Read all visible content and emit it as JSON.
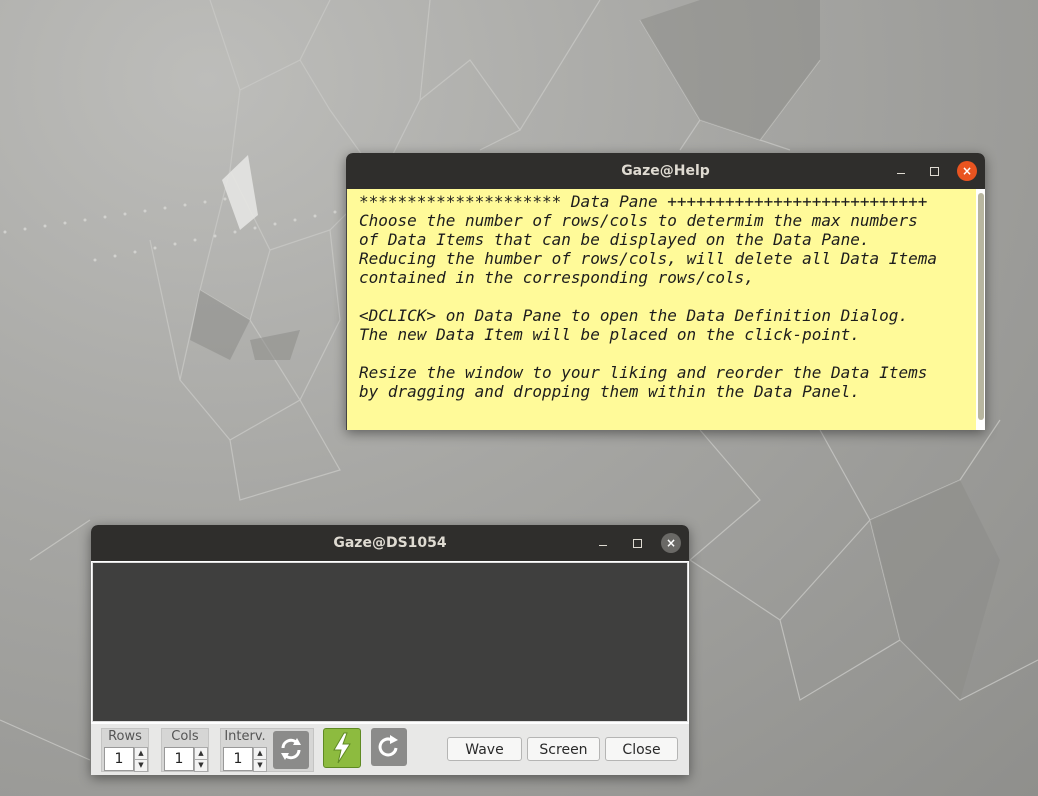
{
  "help_window": {
    "title": "Gaze@Help",
    "text": "********************* Data Pane +++++++++++++++++++++++++++\nChoose the number of rows/cols to determim the max numbers\nof Data Items that can be displayed on the Data Pane.\nReducing the humber of rows/cols, will delete all Data Itema\ncontained in the corresponding rows/cols,\n\n<DCLICK> on Data Pane to open the Data Definition Dialog.\nThe new Data Item will be placed on the click-point.\n\nResize the window to your liking and reorder the Data Items\nby dragging and dropping them within the Data Panel."
  },
  "ds_window": {
    "title": "Gaze@DS1054",
    "rows": {
      "label": "Rows",
      "value": "1"
    },
    "cols": {
      "label": "Cols",
      "value": "1"
    },
    "interval": {
      "label": "Interv.",
      "value": "1"
    },
    "buttons": {
      "wave": "Wave",
      "screen": "Screen",
      "close": "Close"
    },
    "icons": [
      "refresh-icon",
      "run-icon",
      "redo-icon"
    ]
  },
  "window_controls": {
    "minimize": "–",
    "maximize": "□",
    "close": "×"
  },
  "colors": {
    "accent_close": "#e95420",
    "help_background": "#fffa99",
    "data_pane": "#3f3f3e",
    "run_button": "#8dbb3f"
  }
}
